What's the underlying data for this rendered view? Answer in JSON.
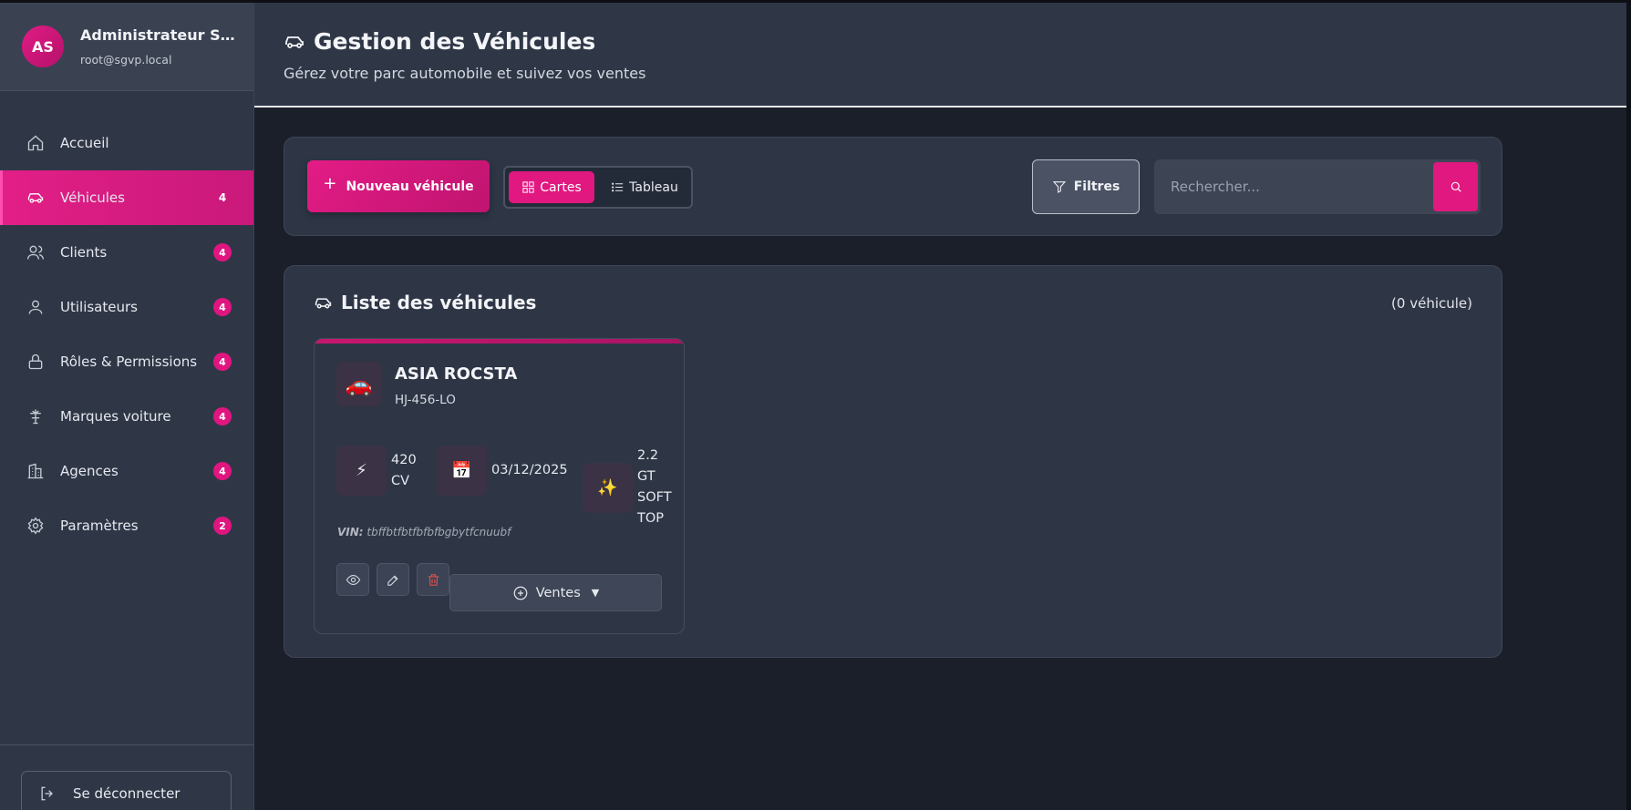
{
  "user": {
    "initials": "AS",
    "name": "Administrateur Super Admin",
    "email": "root@sgvp.local"
  },
  "sidebar": {
    "items": [
      {
        "label": "Accueil",
        "icon": "home-icon",
        "badge": ""
      },
      {
        "label": "Véhicules",
        "icon": "car-icon",
        "badge": "4",
        "active": true
      },
      {
        "label": "Clients",
        "icon": "users-icon",
        "badge": "4"
      },
      {
        "label": "Utilisateurs",
        "icon": "user-icon",
        "badge": "4"
      },
      {
        "label": "Rôles & Permissions",
        "icon": "lock-icon",
        "badge": "4"
      },
      {
        "label": "Marques voiture",
        "icon": "brand-icon",
        "badge": "4"
      },
      {
        "label": "Agences",
        "icon": "building-icon",
        "badge": "4"
      },
      {
        "label": "Paramètres",
        "icon": "gear-icon",
        "badge": "2"
      }
    ],
    "logout_label": "Se déconnecter"
  },
  "header": {
    "title": "Gestion des Véhicules",
    "subtitle": "Gérez votre parc automobile et suivez vos ventes"
  },
  "toolbar": {
    "new_label": "Nouveau véhicule",
    "view_cards_label": "Cartes",
    "view_table_label": "Tableau",
    "filters_label": "Filtres",
    "search_placeholder": "Rechercher...",
    "search_value": ""
  },
  "list": {
    "title": "Liste des véhicules",
    "count_label": "(0 véhicule)",
    "vehicles": [
      {
        "icon": "🚗",
        "name": "ASIA ROCSTA",
        "plate": "HJ-456-LO",
        "power": "420 CV",
        "date": "03/12/2025",
        "version": "2.2 GT SOFT TOP",
        "vin_label": "VIN:",
        "vin": "tbffbtfbtfbfbfbgbytfcnuubf",
        "sales_label": "Ventes"
      }
    ]
  },
  "colors": {
    "accent": "#e0187f",
    "sidebar_bg": "#2f3747",
    "page_bg": "#1b1f29",
    "card_bg": "#2e3646"
  }
}
